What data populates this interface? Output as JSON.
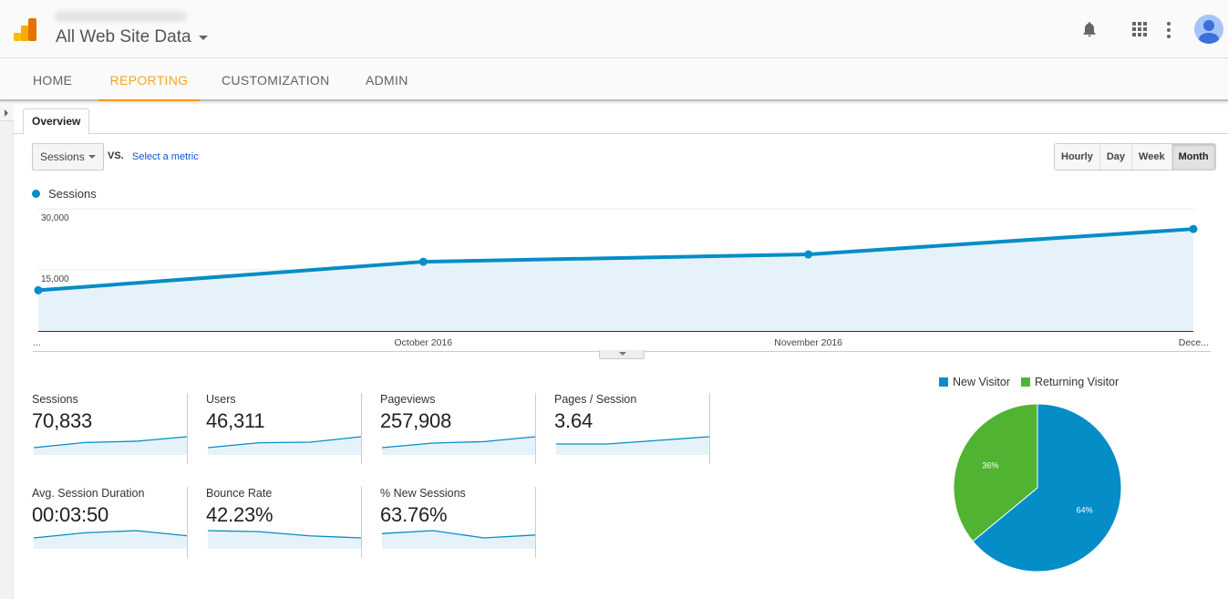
{
  "header": {
    "property_name": "All Web Site Data",
    "icons": [
      "analytics-logo-icon",
      "bell-icon",
      "apps-grid-icon",
      "more-vert-icon",
      "account-avatar-icon"
    ]
  },
  "nav": {
    "tabs": [
      {
        "label": "HOME",
        "active": false
      },
      {
        "label": "REPORTING",
        "active": true
      },
      {
        "label": "CUSTOMIZATION",
        "active": false
      },
      {
        "label": "ADMIN",
        "active": false
      }
    ]
  },
  "report": {
    "tab_label": "Overview",
    "metric_select": "Sessions",
    "vs_label": "VS.",
    "select_metric_link": "Select a metric",
    "granularity": [
      {
        "label": "Hourly",
        "active": false
      },
      {
        "label": "Day",
        "active": false
      },
      {
        "label": "Week",
        "active": false
      },
      {
        "label": "Month",
        "active": true
      }
    ],
    "legend_label": "Sessions"
  },
  "colors": {
    "accent": "#f29900",
    "series_blue": "#058dc7",
    "series_fill": "#e6f2fa",
    "series_green": "#50b432",
    "link": "#1155cc"
  },
  "scorecards": [
    {
      "label": "Sessions",
      "value": "70,833",
      "trend": [
        10,
        17,
        18.8,
        25
      ]
    },
    {
      "label": "Users",
      "value": "46,311",
      "trend": [
        6.5,
        11,
        11.5,
        16.5
      ]
    },
    {
      "label": "Pageviews",
      "value": "257,908",
      "trend": [
        36,
        60,
        68,
        94
      ]
    },
    {
      "label": "Pages / Session",
      "value": "3.64",
      "trend": [
        3.6,
        3.6,
        3.65,
        3.7
      ]
    },
    {
      "label": "Avg. Session Duration",
      "value": "00:03:50",
      "trend": [
        225,
        232,
        235,
        228
      ]
    },
    {
      "label": "Bounce Rate",
      "value": "42.23%",
      "trend": [
        44,
        43.5,
        41.5,
        40.5
      ]
    },
    {
      "label": "% New Sessions",
      "value": "63.76%",
      "trend": [
        63.8,
        64,
        63.5,
        63.7
      ]
    }
  ],
  "chart_data": [
    {
      "type": "area",
      "title": "",
      "series": [
        {
          "name": "Sessions",
          "values": [
            10000,
            17000,
            18800,
            25033
          ]
        }
      ],
      "x": [
        "...",
        "October 2016",
        "November 2016",
        "Dece..."
      ],
      "y_ticks": [
        "30,000",
        "15,000"
      ],
      "ylim": [
        0,
        30000
      ],
      "grid": true,
      "legend": "top-left"
    },
    {
      "type": "pie",
      "title": "",
      "categories": [
        "New Visitor",
        "Returning Visitor"
      ],
      "values": [
        64,
        36
      ],
      "labels": [
        "64%",
        "36%"
      ],
      "legend": "top"
    }
  ]
}
